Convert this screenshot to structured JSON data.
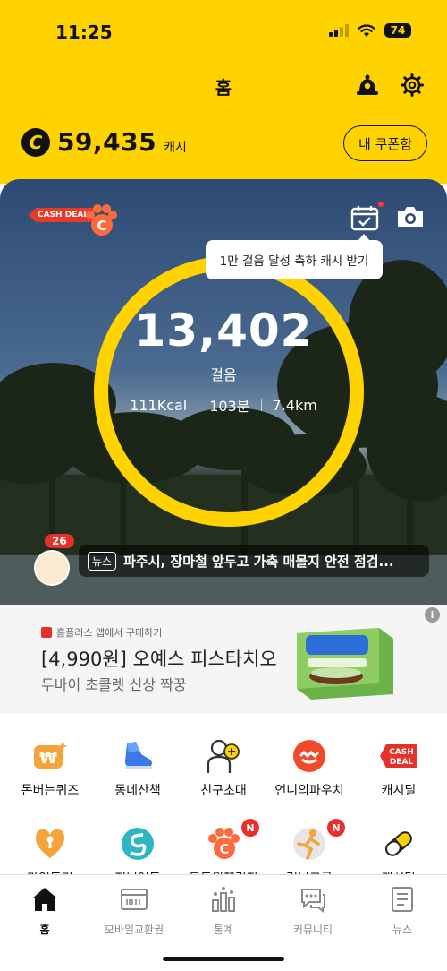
{
  "status": {
    "time": "11:25",
    "battery": "74"
  },
  "header": {
    "title": "홈",
    "icons": [
      "alarm-bell-icon",
      "gear-icon"
    ]
  },
  "cash": {
    "coin_symbol": "C",
    "amount": "59,435",
    "unit": "캐시",
    "coupon_label": "내 쿠폰함"
  },
  "hero": {
    "cashdeal_tag": "CASH DEAL",
    "tooltip": "1만 걸음 달성 축하 캐시 받기",
    "steps": "13,402",
    "steps_label": "걸음",
    "kcal": "111Kcal",
    "minutes": "103분",
    "distance": "7.4km",
    "news_count": "26",
    "news_tag": "뉴스",
    "news_headline": "파주시, 장마철 앞두고 가축 매몰지 안전 점검..."
  },
  "ad": {
    "source": "홈플러스 앱에서 구매하기",
    "title": "[4,990원] 오예스 피스타치오",
    "subtitle": "두바이 초콜렛 신상 짝꿍",
    "info": "i"
  },
  "shortcuts": [
    {
      "label": "돈버는퀴즈",
      "icon": "won-coin-icon"
    },
    {
      "label": "동네산책",
      "icon": "sneaker-icon"
    },
    {
      "label": "친구초대",
      "icon": "person-plus-icon"
    },
    {
      "label": "언니의파우치",
      "icon": "pouch-icon"
    },
    {
      "label": "캐시딜",
      "icon": "cashdeal-icon"
    },
    {
      "label": "마인드키",
      "icon": "keyhole-heart-icon"
    },
    {
      "label": "지니어트",
      "icon": "swirl-icon"
    },
    {
      "label": "모드위챌리지",
      "icon": "paw-coin-icon",
      "badge": "N"
    },
    {
      "label": "러닝크루",
      "icon": "runner-icon",
      "badge": "N"
    },
    {
      "label": "캐시닥",
      "icon": "pill-icon"
    }
  ],
  "tabs": [
    {
      "label": "홈",
      "icon": "home-icon",
      "active": true
    },
    {
      "label": "모바일교환권",
      "icon": "voucher-icon"
    },
    {
      "label": "통계",
      "icon": "stats-icon"
    },
    {
      "label": "커뮤니티",
      "icon": "chat-icon"
    },
    {
      "label": "뉴스",
      "icon": "news-icon"
    }
  ],
  "colors": {
    "brand_yellow": "#ffd300",
    "accent_red": "#e8302a"
  }
}
